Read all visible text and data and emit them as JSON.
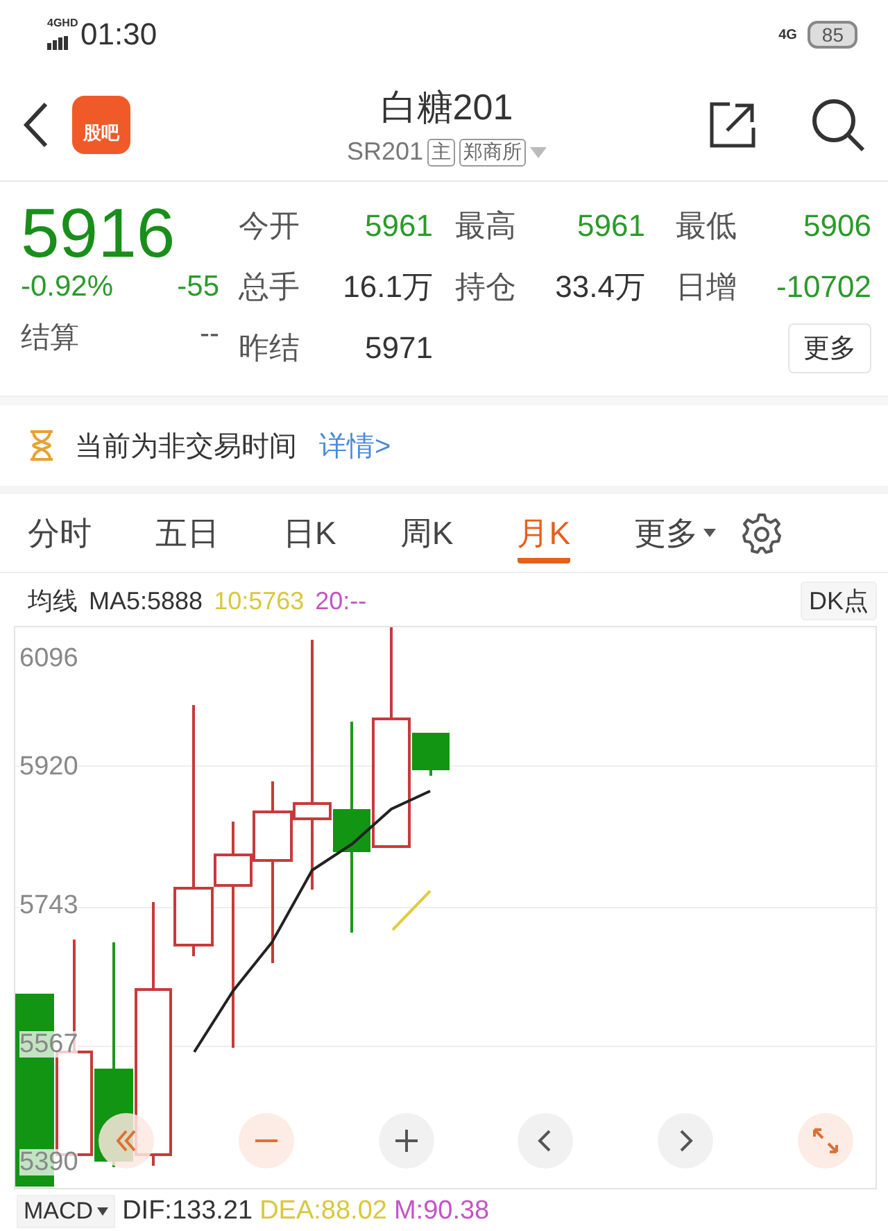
{
  "status_bar": {
    "network": "4GHD",
    "time": "01:30",
    "network_right": "4G",
    "battery": "85"
  },
  "header": {
    "app_badge": "股吧",
    "title": "白糖201",
    "code": "SR201",
    "tags": [
      "主",
      "郑商所"
    ]
  },
  "quote": {
    "price": "5916",
    "change_pct": "-0.92%",
    "change": "-55",
    "settle_label": "结算",
    "settle_value": "--",
    "rows": [
      [
        {
          "label": "今开",
          "value": "5961",
          "color": "#2a9a2a"
        },
        {
          "label": "最高",
          "value": "5961",
          "color": "#2a9a2a"
        },
        {
          "label": "最低",
          "value": "5906",
          "color": "#2a9a2a"
        }
      ],
      [
        {
          "label": "总手",
          "value": "16.1万",
          "color": "#333333"
        },
        {
          "label": "持仓",
          "value": "33.4万",
          "color": "#333333"
        },
        {
          "label": "日增",
          "value": "-10702",
          "color": "#2a9a2a"
        }
      ],
      [
        {
          "label": "昨结",
          "value": "5971",
          "color": "#333333"
        }
      ]
    ],
    "more_button": "更多"
  },
  "notice": {
    "text": "当前为非交易时间",
    "link": "详情>"
  },
  "tabs": [
    {
      "label": "分时",
      "selected": false,
      "has_menu": false
    },
    {
      "label": "五日",
      "selected": false,
      "has_menu": false
    },
    {
      "label": "日K",
      "selected": false,
      "has_menu": false
    },
    {
      "label": "周K",
      "selected": false,
      "has_menu": false
    },
    {
      "label": "月K",
      "selected": true,
      "has_menu": false
    },
    {
      "label": "更多",
      "selected": false,
      "has_menu": true
    }
  ],
  "ma_legend": {
    "label": "均线",
    "items": [
      {
        "text": "MA5:5888",
        "color": "#333333"
      },
      {
        "text": "10:5763",
        "color": "#d8c83c"
      },
      {
        "text": "20:--",
        "color": "#c454c4"
      }
    ],
    "button": "DK点"
  },
  "chart": {
    "y_labels": [
      "6096",
      "5920",
      "5743",
      "5567",
      "5390"
    ],
    "controls": [
      {
        "kind": "rewind"
      },
      {
        "kind": "zoom_out"
      },
      {
        "kind": "zoom_in"
      },
      {
        "kind": "prev"
      },
      {
        "kind": "next"
      },
      {
        "kind": "fullscreen"
      }
    ]
  },
  "macd": {
    "selector": "MACD",
    "items": [
      {
        "text": "DIF:133.21",
        "color": "#333333"
      },
      {
        "text": "DEA:88.02",
        "color": "#d8c83c"
      },
      {
        "text": "M:90.38",
        "color": "#c454c4"
      }
    ]
  }
}
